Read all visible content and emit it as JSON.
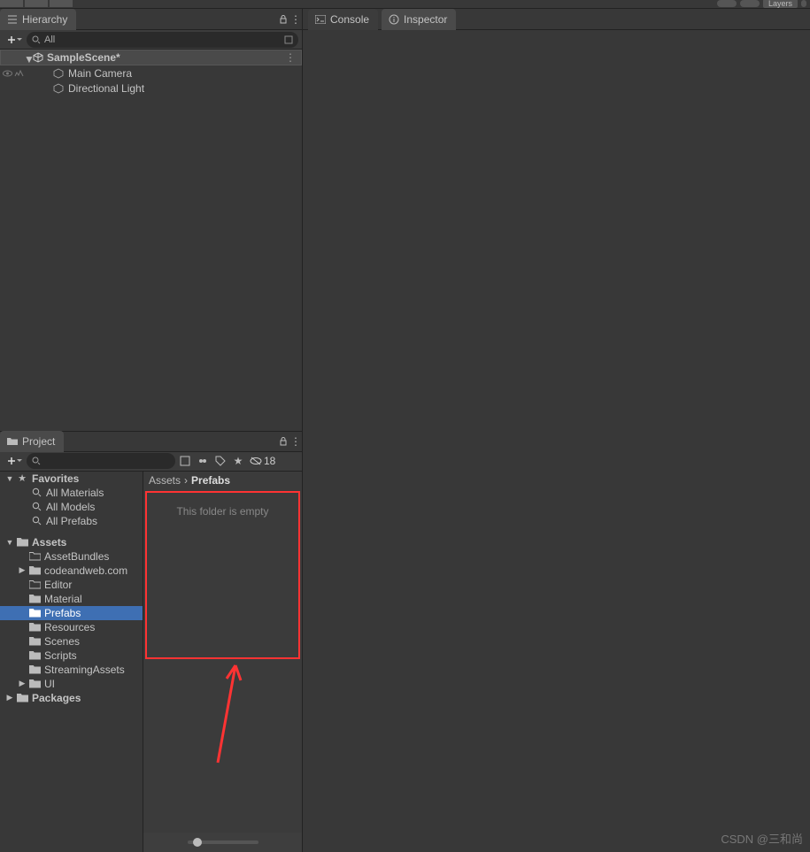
{
  "toolbar_top": {
    "layers_label": "Layers"
  },
  "hierarchy": {
    "title": "Hierarchy",
    "search_value": "All",
    "scene": "SampleScene*",
    "objects": [
      "Main Camera",
      "Directional Light"
    ]
  },
  "project": {
    "title": "Project",
    "hidden_count": "18",
    "breadcrumb": {
      "root": "Assets",
      "current": "Prefabs"
    },
    "empty_text": "This folder is empty",
    "favorites": {
      "label": "Favorites",
      "items": [
        "All Materials",
        "All Models",
        "All Prefabs"
      ]
    },
    "assets": {
      "label": "Assets",
      "children": [
        {
          "label": "AssetBundles",
          "icon": "folder-outline"
        },
        {
          "label": "codeandweb.com",
          "icon": "folder-solid",
          "expandable": true
        },
        {
          "label": "Editor",
          "icon": "folder-outline"
        },
        {
          "label": "Material",
          "icon": "folder-solid"
        },
        {
          "label": "Prefabs",
          "icon": "folder-outline",
          "selected": true
        },
        {
          "label": "Resources",
          "icon": "folder-solid"
        },
        {
          "label": "Scenes",
          "icon": "folder-solid"
        },
        {
          "label": "Scripts",
          "icon": "folder-solid"
        },
        {
          "label": "StreamingAssets",
          "icon": "folder-solid"
        },
        {
          "label": "UI",
          "icon": "folder-solid",
          "expandable": true
        }
      ]
    },
    "packages": {
      "label": "Packages"
    }
  },
  "right_tabs": {
    "console": "Console",
    "inspector": "Inspector"
  },
  "watermark": "CSDN @三和尚"
}
